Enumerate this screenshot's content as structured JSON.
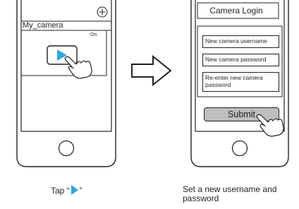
{
  "left_phone": {
    "camera_name": "My_camera",
    "camera_status": "On",
    "icons": [
      "add-circle-icon",
      "play-icon",
      "hand-pointer-icon",
      "home-button-icon"
    ]
  },
  "arrow": {
    "icon": "right-arrow-icon"
  },
  "right_phone": {
    "title": "Camera Login",
    "username_placeholder": "New camera username",
    "password_placeholder": "New camera password",
    "reenter_placeholder": "Re-enter new camera password",
    "submit_label": "Submit",
    "icons": [
      "hand-pointer-icon",
      "home-button-icon"
    ]
  },
  "captions": {
    "left_prefix": "Tap “",
    "left_suffix": "”",
    "right": "Set a new username and password"
  },
  "colors": {
    "play_accent": "#2fa8dc",
    "submit_fill": "#bcbec0",
    "outline": "#231f20"
  }
}
